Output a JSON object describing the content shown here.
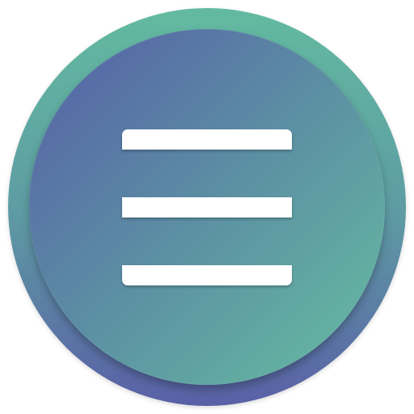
{
  "icon": {
    "name": "hamburger-menu-icon",
    "lines": 3,
    "colors": {
      "ring_top": "#63BAA0",
      "ring_mid": "#5E9DA3",
      "ring_bottom": "#5960A6",
      "disc_start": "#555EA8",
      "disc_mid": "#5C8FA3",
      "disc_end": "#66BEA2",
      "bar": "#FFFFFF"
    }
  }
}
